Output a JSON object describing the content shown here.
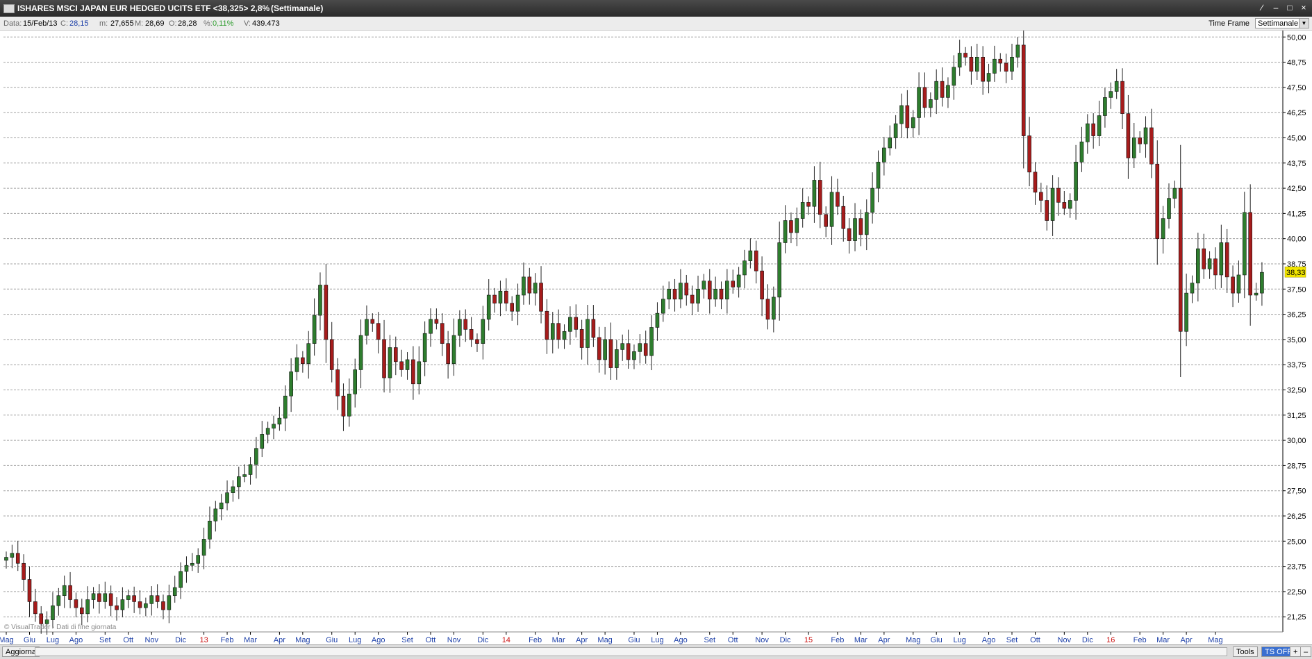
{
  "window": {
    "title": "ISHARES MSCI JAPAN EUR HEDGED UCITS ETF <38,325> 2,8%",
    "timeframe": "(Settimanale)",
    "buttons": [
      "∕",
      "–",
      "□",
      "×"
    ]
  },
  "infobar": {
    "date_label": "Data:",
    "date_value": "15/Feb/13",
    "close_label": "C:",
    "close_value": "28,15",
    "min_label": "m:",
    "min_value": "27,655",
    "max_label": "M:",
    "max_value": "28,69",
    "open_label": "O:",
    "open_value": "28,28",
    "pct_label": "%:",
    "pct_value": "0,11%",
    "vol_label": "V:",
    "vol_value": "439.473",
    "timeframe_label": "Time Frame",
    "timeframe_value": "Settimanale"
  },
  "statusbar": {
    "refresh": "Aggiorna",
    "tools": "Tools",
    "ts_off": "TS OFF",
    "plus": "+",
    "minus": "–"
  },
  "colors": {
    "up": "#2e7d2e",
    "down": "#a61c1c",
    "grid": "#a0a0a0",
    "price_tag": "#f2e600",
    "month_label": "#1c3fa8",
    "year_label": "#cc1111"
  },
  "chart_data": {
    "type": "candlestick",
    "title": "ISHARES MSCI JAPAN EUR HEDGED UCITS ETF",
    "ylim": [
      20.5,
      50.25
    ],
    "y_ticks": [
      21.25,
      22.5,
      23.75,
      25,
      26.25,
      27.5,
      28.75,
      30,
      31.25,
      32.5,
      33.75,
      35,
      36.25,
      37.5,
      38.75,
      40,
      41.25,
      42.5,
      43.75,
      45,
      46.25,
      47.5,
      48.75,
      50
    ],
    "last_price_label": "38,33",
    "last_price": 38.33,
    "watermark": "© VisualTrader - Dati di fine giornata",
    "x_ticks": [
      {
        "label": "Mag",
        "week": 0,
        "year": false
      },
      {
        "label": "Giu",
        "week": 4,
        "year": false
      },
      {
        "label": "Lug",
        "week": 8,
        "year": false
      },
      {
        "label": "Ago",
        "week": 12,
        "year": false
      },
      {
        "label": "Set",
        "week": 17,
        "year": false
      },
      {
        "label": "Ott",
        "week": 21,
        "year": false
      },
      {
        "label": "Nov",
        "week": 25,
        "year": false
      },
      {
        "label": "Dic",
        "week": 30,
        "year": false
      },
      {
        "label": "13",
        "week": 34,
        "year": true
      },
      {
        "label": "Feb",
        "week": 38,
        "year": false
      },
      {
        "label": "Mar",
        "week": 42,
        "year": false
      },
      {
        "label": "Apr",
        "week": 47,
        "year": false
      },
      {
        "label": "Mag",
        "week": 51,
        "year": false
      },
      {
        "label": "Giu",
        "week": 56,
        "year": false
      },
      {
        "label": "Lug",
        "week": 60,
        "year": false
      },
      {
        "label": "Ago",
        "week": 64,
        "year": false
      },
      {
        "label": "Set",
        "week": 69,
        "year": false
      },
      {
        "label": "Ott",
        "week": 73,
        "year": false
      },
      {
        "label": "Nov",
        "week": 77,
        "year": false
      },
      {
        "label": "Dic",
        "week": 82,
        "year": false
      },
      {
        "label": "14",
        "week": 86,
        "year": true
      },
      {
        "label": "Feb",
        "week": 91,
        "year": false
      },
      {
        "label": "Mar",
        "week": 95,
        "year": false
      },
      {
        "label": "Apr",
        "week": 99,
        "year": false
      },
      {
        "label": "Mag",
        "week": 103,
        "year": false
      },
      {
        "label": "Giu",
        "week": 108,
        "year": false
      },
      {
        "label": "Lug",
        "week": 112,
        "year": false
      },
      {
        "label": "Ago",
        "week": 116,
        "year": false
      },
      {
        "label": "Set",
        "week": 121,
        "year": false
      },
      {
        "label": "Ott",
        "week": 125,
        "year": false
      },
      {
        "label": "Nov",
        "week": 130,
        "year": false
      },
      {
        "label": "Dic",
        "week": 134,
        "year": false
      },
      {
        "label": "15",
        "week": 138,
        "year": true
      },
      {
        "label": "Feb",
        "week": 143,
        "year": false
      },
      {
        "label": "Mar",
        "week": 147,
        "year": false
      },
      {
        "label": "Apr",
        "week": 151,
        "year": false
      },
      {
        "label": "Mag",
        "week": 156,
        "year": false
      },
      {
        "label": "Giu",
        "week": 160,
        "year": false
      },
      {
        "label": "Lug",
        "week": 164,
        "year": false
      },
      {
        "label": "Ago",
        "week": 169,
        "year": false
      },
      {
        "label": "Set",
        "week": 173,
        "year": false
      },
      {
        "label": "Ott",
        "week": 177,
        "year": false
      },
      {
        "label": "Nov",
        "week": 182,
        "year": false
      },
      {
        "label": "Dic",
        "week": 186,
        "year": false
      },
      {
        "label": "16",
        "week": 190,
        "year": true
      },
      {
        "label": "Feb",
        "week": 195,
        "year": false
      },
      {
        "label": "Mar",
        "week": 199,
        "year": false
      },
      {
        "label": "Apr",
        "week": 203,
        "year": false
      },
      {
        "label": "Mag",
        "week": 208,
        "year": false
      }
    ],
    "closes": [
      24.2,
      24.4,
      23.9,
      23.1,
      22.0,
      21.4,
      20.9,
      21.1,
      21.8,
      22.3,
      22.8,
      22.1,
      21.7,
      21.4,
      22.1,
      22.4,
      22.0,
      22.4,
      21.8,
      21.6,
      22.1,
      22.3,
      22.0,
      21.7,
      21.9,
      22.3,
      22.0,
      21.6,
      22.3,
      22.7,
      23.5,
      23.8,
      23.9,
      24.3,
      25.1,
      26.0,
      26.6,
      26.9,
      27.4,
      27.7,
      28.2,
      28.3,
      28.8,
      29.6,
      30.3,
      30.6,
      30.8,
      31.1,
      32.2,
      33.4,
      34.1,
      33.8,
      34.8,
      36.2,
      37.7,
      35.0,
      33.5,
      32.2,
      31.2,
      32.3,
      33.5,
      35.2,
      36.0,
      35.8,
      35.0,
      33.1,
      34.6,
      33.9,
      33.5,
      34.0,
      32.8,
      33.9,
      35.3,
      36.0,
      35.8,
      34.8,
      33.8,
      35.2,
      36.0,
      35.5,
      35.0,
      34.8,
      36.0,
      37.2,
      36.8,
      37.4,
      36.8,
      36.4,
      37.2,
      38.1,
      37.3,
      37.8,
      36.4,
      35.0,
      35.8,
      35.0,
      35.4,
      36.1,
      35.5,
      34.6,
      36.0,
      35.1,
      34.0,
      35.0,
      33.6,
      34.5,
      34.8,
      34.0,
      34.4,
      34.8,
      34.2,
      35.6,
      36.3,
      37.0,
      37.5,
      37.0,
      37.8,
      37.2,
      36.8,
      37.5,
      37.9,
      37.0,
      37.5,
      37.0,
      37.9,
      37.6,
      38.2,
      38.9,
      39.4,
      38.4,
      37.0,
      36.0,
      37.1,
      39.8,
      40.9,
      40.3,
      41.0,
      41.8,
      41.6,
      42.9,
      41.2,
      40.6,
      42.3,
      41.6,
      40.5,
      39.9,
      41.0,
      40.2,
      41.3,
      42.5,
      43.8,
      44.5,
      45.0,
      45.7,
      46.6,
      45.5,
      46.0,
      47.5,
      46.5,
      46.9,
      47.8,
      47.0,
      47.6,
      48.5,
      49.2,
      49.0,
      48.3,
      49.0,
      47.8,
      48.2,
      48.9,
      48.7,
      48.3,
      49.0,
      49.6,
      45.1,
      43.3,
      42.3,
      41.9,
      40.9,
      42.5,
      41.8,
      41.5,
      41.9,
      43.8,
      44.8,
      45.7,
      45.1,
      46.1,
      47.0,
      47.3,
      47.8,
      46.2,
      44.0,
      45.0,
      44.7,
      45.5,
      43.7,
      40.0,
      41.0,
      42.0,
      42.5,
      35.4,
      37.3,
      37.8,
      39.5,
      38.5,
      39.0,
      38.2,
      39.8,
      38.1,
      37.3,
      38.2,
      41.3,
      37.2,
      37.3,
      38.33
    ]
  }
}
